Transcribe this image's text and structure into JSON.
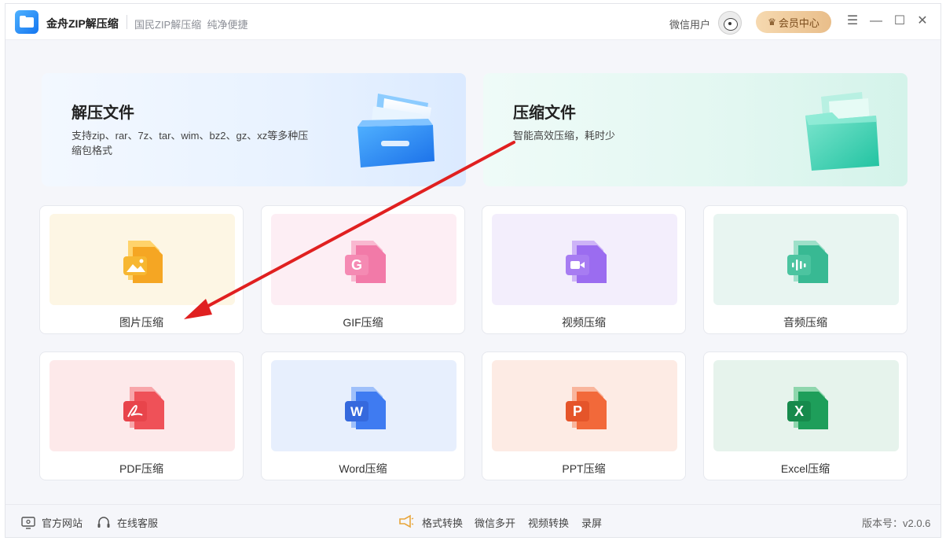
{
  "titlebar": {
    "app_name": "金舟ZIP解压缩",
    "slogan": "国民ZIP解压缩  纯净便捷",
    "user_name": "微信用户",
    "vip_label": "会员中心",
    "menu_glyph": "☰",
    "minimize_glyph": "—",
    "maximize_glyph": "☐",
    "close_glyph": "✕"
  },
  "hero": {
    "extract": {
      "title": "解压文件",
      "desc": "支持zip、rar、7z、tar、wim、bz2、gz、xz等多种压缩包格式"
    },
    "compress": {
      "title": "压缩文件",
      "desc": "智能高效压缩，耗时少"
    }
  },
  "tools": [
    {
      "label": "图片压缩",
      "icon": "image-file-icon",
      "bg": "#fdf6e4",
      "color": "#f5a623",
      "glyph": ""
    },
    {
      "label": "GIF压缩",
      "icon": "gif-file-icon",
      "bg": "#fdeef4",
      "color": "#f27aa8",
      "glyph": "G"
    },
    {
      "label": "视频压缩",
      "icon": "video-file-icon",
      "bg": "#f3eefc",
      "color": "#9b6cf0",
      "glyph": ""
    },
    {
      "label": "音频压缩",
      "icon": "audio-file-icon",
      "bg": "#e8f5f1",
      "color": "#38b993",
      "glyph": ""
    },
    {
      "label": "PDF压缩",
      "icon": "pdf-file-icon",
      "bg": "#fde9ea",
      "color": "#ef5158",
      "glyph": ""
    },
    {
      "label": "Word压缩",
      "icon": "word-file-icon",
      "bg": "#e7effd",
      "color": "#3f7bf1",
      "glyph": "W"
    },
    {
      "label": "PPT压缩",
      "icon": "ppt-file-icon",
      "bg": "#fdebe4",
      "color": "#f2693a",
      "glyph": "P"
    },
    {
      "label": "Excel压缩",
      "icon": "excel-file-icon",
      "bg": "#e6f3ec",
      "color": "#1e9e5a",
      "glyph": "X"
    }
  ],
  "footer": {
    "website": "官方网站",
    "support": "在线客服",
    "links": [
      "格式转换",
      "微信多开",
      "视频转换",
      "录屏"
    ],
    "version": "版本号：v2.0.6"
  },
  "colors": {
    "accent": "#1476f0",
    "annotation_arrow": "#e02020"
  }
}
